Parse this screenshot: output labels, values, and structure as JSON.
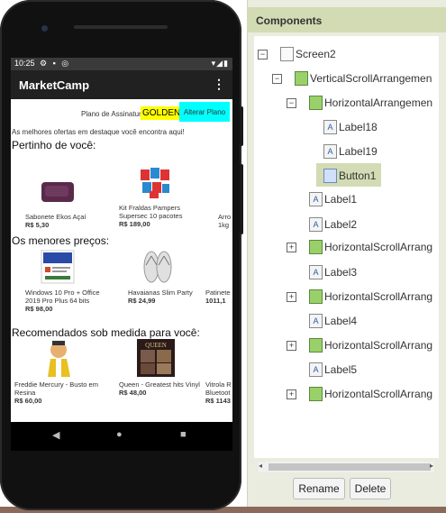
{
  "status_bar": {
    "time": "10:25",
    "left_icons": "⚙ ▪ ◎",
    "right_icons": "▾◢▮"
  },
  "app": {
    "title": "MarketCamp",
    "menu_glyph": "⋮"
  },
  "plan": {
    "label": "Plano de Assinatura Atual:",
    "value": "GOLDEN",
    "button": "Alterar Plano"
  },
  "offers_text": "As melhores ofertas em destaque você encontra aqui!",
  "sections": [
    {
      "title": "Pertinho de você:",
      "products": [
        {
          "name": "Sabonete Ekos Açaí",
          "price": "R$ 5,30"
        },
        {
          "name": "Kit Fraldas Pampers Supersec 10 pacotes",
          "price": "R$ 189,00"
        },
        {
          "name": "Arro",
          "price": "1kg"
        }
      ]
    },
    {
      "title": "Os menores preços:",
      "products": [
        {
          "name": "Windows 10 Pro + Office 2019 Pro Plus 64 bits",
          "price": "R$ 98,00"
        },
        {
          "name": "Havaianas Slim Party",
          "price": "R$ 24,99"
        },
        {
          "name": "Patinete",
          "price": "1011,1"
        }
      ]
    },
    {
      "title": "Recomendados sob medida para você:",
      "products": [
        {
          "name": "Freddie Mercury - Busto em Resina",
          "price": "R$ 60,00"
        },
        {
          "name": "Queen - Greatest hits Vinyl",
          "price": "R$ 48,00"
        },
        {
          "name": "Vitrola R Bluetoot",
          "price": "R$ 1143"
        }
      ]
    }
  ],
  "nav": {
    "back": "◀",
    "home": "●",
    "recents": "■"
  },
  "panel": {
    "title": "Components",
    "tree": [
      {
        "label": "Screen2",
        "toggle": "⊟",
        "icon": ""
      },
      {
        "label": "VerticalScrollArrangemen",
        "toggle": "⊟",
        "icon": ""
      },
      {
        "label": "HorizontalArrangemen",
        "toggle": "⊟",
        "icon": ""
      },
      {
        "label": "Label18",
        "toggle": "",
        "icon": "A"
      },
      {
        "label": "Label19",
        "toggle": "",
        "icon": "A"
      },
      {
        "label": "Button1",
        "toggle": "",
        "icon": ""
      },
      {
        "label": "Label1",
        "toggle": "",
        "icon": "A"
      },
      {
        "label": "Label2",
        "toggle": "",
        "icon": "A"
      },
      {
        "label": "HorizontalScrollArrang",
        "toggle": "⊞",
        "icon": ""
      },
      {
        "label": "Label3",
        "toggle": "",
        "icon": "A"
      },
      {
        "label": "HorizontalScrollArrang",
        "toggle": "⊞",
        "icon": ""
      },
      {
        "label": "Label4",
        "toggle": "",
        "icon": "A"
      },
      {
        "label": "HorizontalScrollArrang",
        "toggle": "⊞",
        "icon": ""
      },
      {
        "label": "Label5",
        "toggle": "",
        "icon": "A"
      },
      {
        "label": "HorizontalScrollArrang",
        "toggle": "⊞",
        "icon": ""
      }
    ],
    "scroll_left": "◂",
    "scroll_right": "▸",
    "rename_button": "Rename",
    "delete_button": "Delete"
  },
  "colors": {
    "plan_highlight": "#ffff00",
    "plan_button": "#00ffff",
    "panel_header": "#d2dbb4",
    "app_bar": "#212121"
  }
}
